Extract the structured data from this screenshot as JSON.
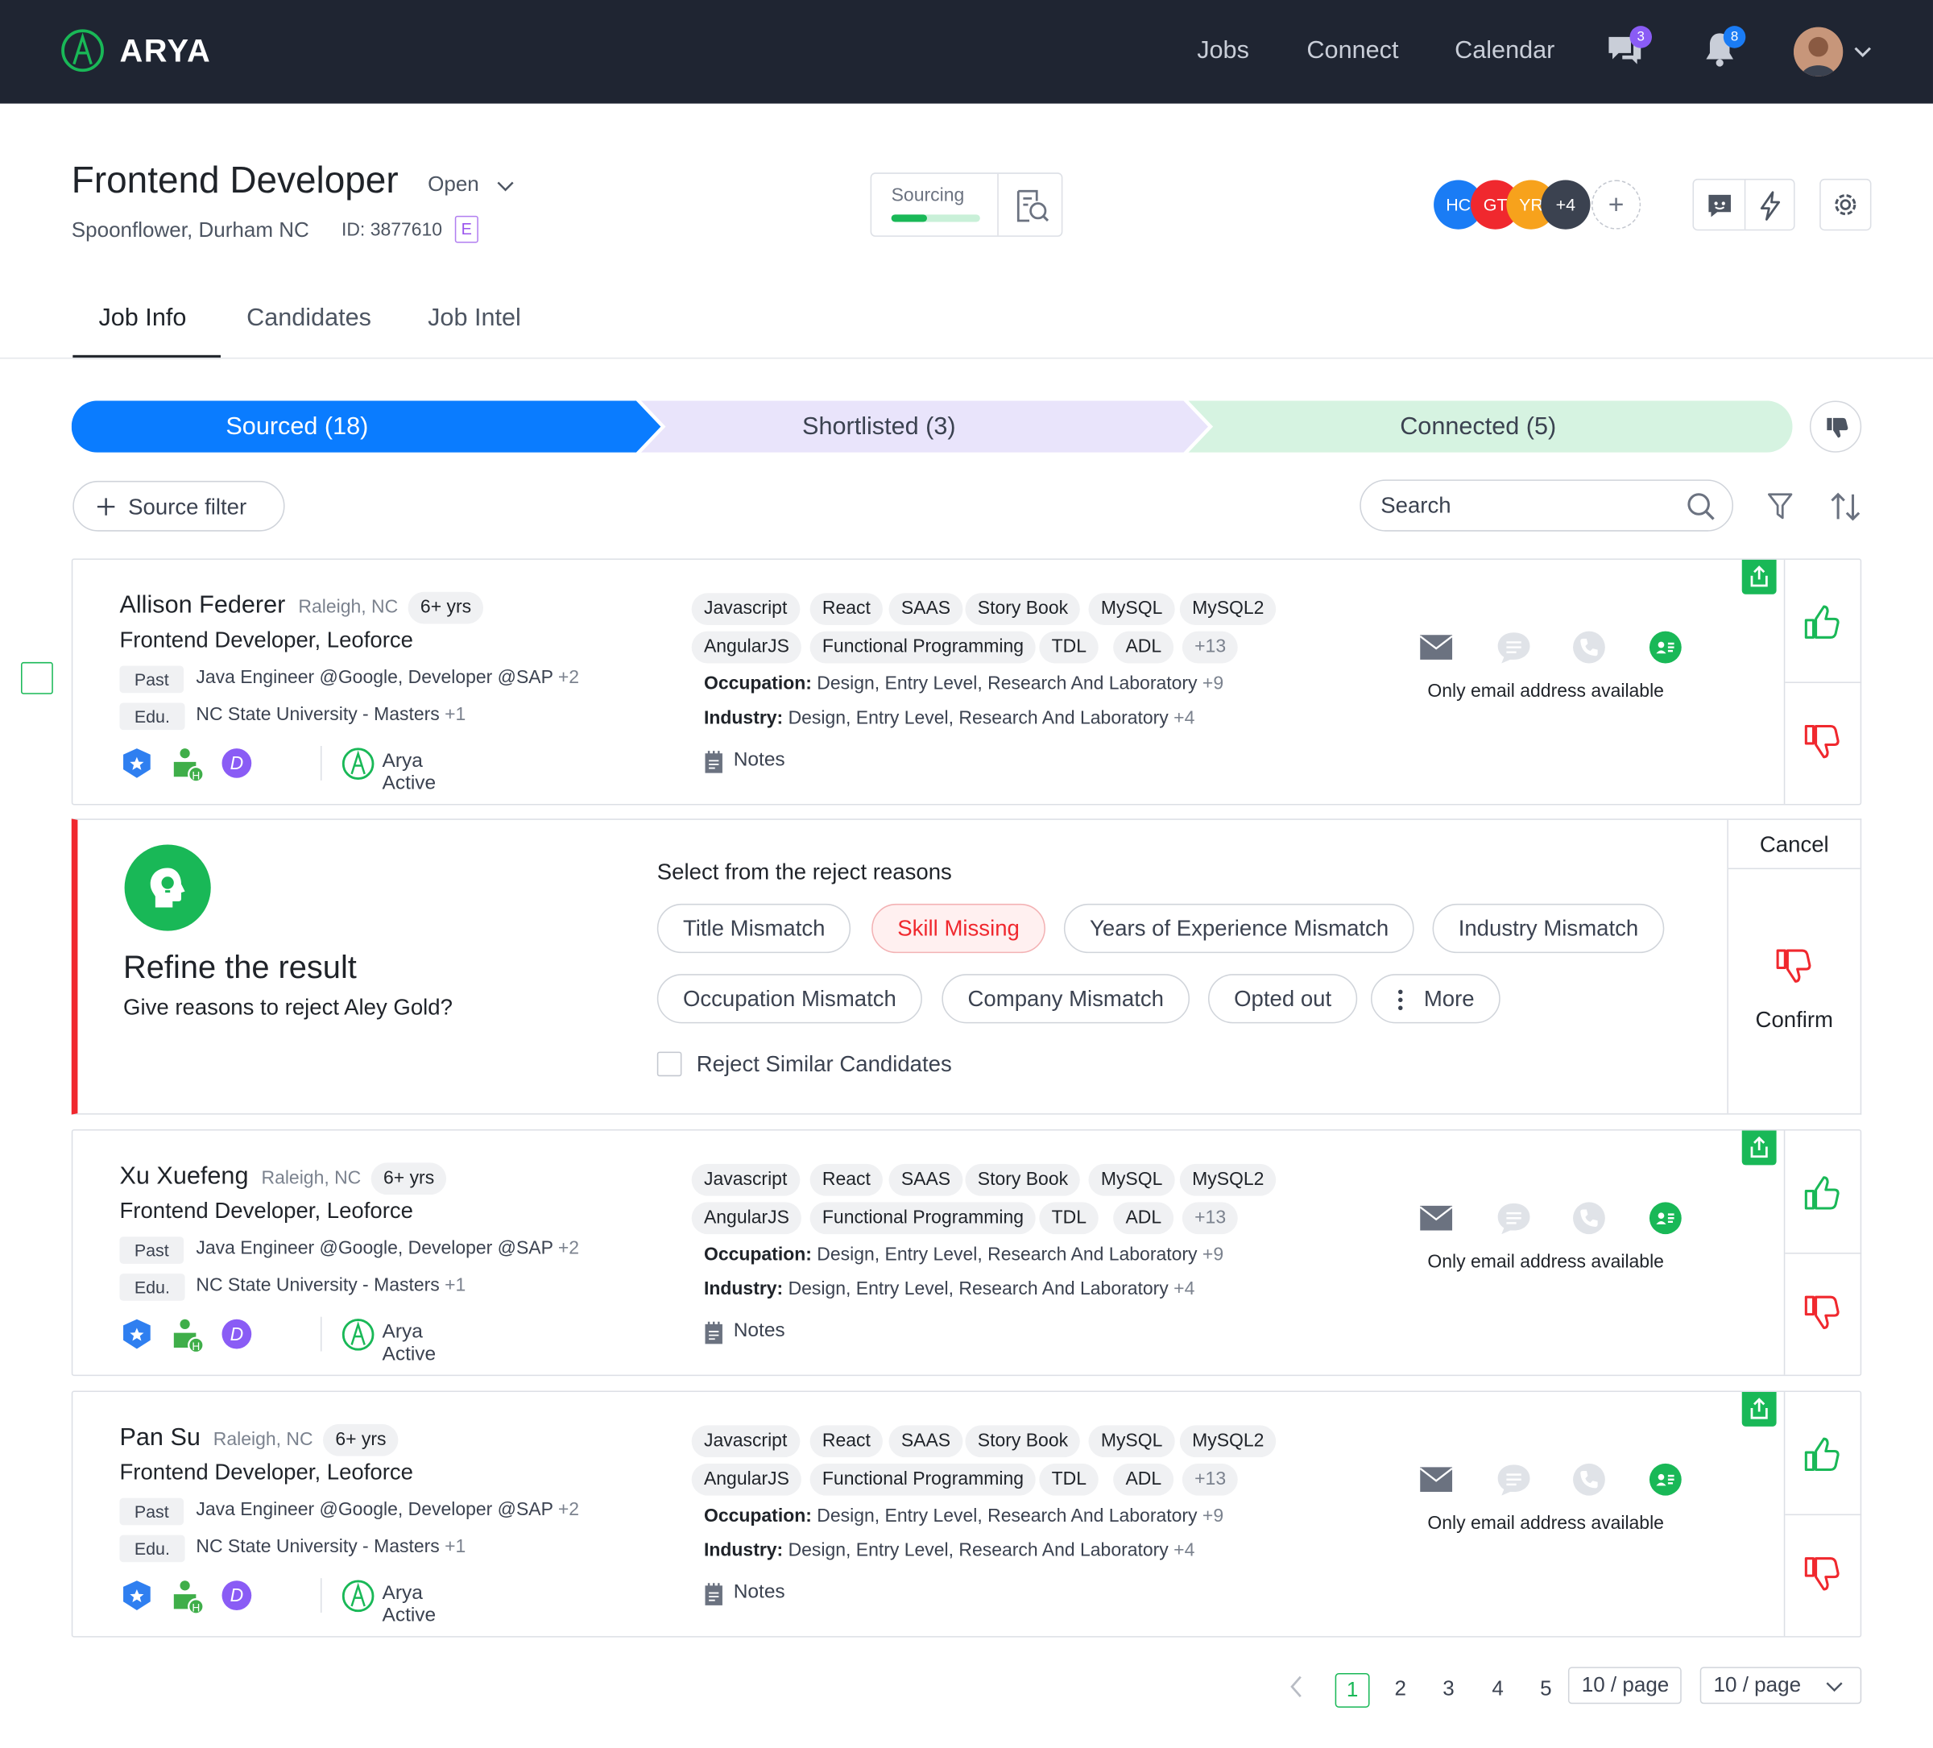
{
  "nav": {
    "brand": "ARYA",
    "links": [
      "Jobs",
      "Connect",
      "Calendar"
    ],
    "chat_badge": "3",
    "notif_badge": "8",
    "colors": {
      "bg": "#1f2532",
      "brand_green": "#19b857"
    }
  },
  "job": {
    "title": "Frontend Developer",
    "status": "Open",
    "location": "Spoonflower, Durham NC",
    "id": "ID: 3877610",
    "tag": "E",
    "sourcing_label": "Sourcing",
    "sourcing_progress": 0.4,
    "team": [
      {
        "initials": "HC",
        "color": "#1a7cf5"
      },
      {
        "initials": "GT",
        "color": "#f0282e"
      },
      {
        "initials": "YR",
        "color": "#f7a21c"
      },
      {
        "initials": "+4",
        "color": "#3b4250"
      }
    ],
    "team_add": "+"
  },
  "tabs": [
    "Job Info",
    "Candidates",
    "Job Intel"
  ],
  "pipeline": {
    "stages": [
      {
        "label": "Sourced (18)",
        "color": "#0a7cff"
      },
      {
        "label": "Shortlisted (3)",
        "color": "#e9e4fb"
      },
      {
        "label": "Connected (5)",
        "color": "#d6f3e1"
      }
    ]
  },
  "filters": {
    "source_filter": "Source filter",
    "search_placeholder": "Search"
  },
  "candidates": [
    {
      "name": "Allison Federer",
      "location": "Raleigh, NC",
      "experience": "6+ yrs",
      "title": "Frontend Developer, Leoforce",
      "past_label": "Past",
      "past": "Java Engineer @Google, Developer @SAP",
      "past_more": "+2",
      "edu_label": "Edu.",
      "edu": "NC State University - Masters",
      "edu_more": "+1",
      "status": "Arya Active",
      "skills_row1": [
        "Javascript",
        "React",
        "SAAS",
        "Story Book",
        "MySQL",
        "MySQL2"
      ],
      "skills_row2": [
        "AngularJS",
        "Functional Programming",
        "TDL",
        "ADL",
        "+13"
      ],
      "occupation_label": "Occupation:",
      "occupation": "Design, Entry Level, Research And Laboratory",
      "occupation_more": "+9",
      "industry_label": "Industry:",
      "industry": "Design, Entry Level, Research And Laboratory",
      "industry_more": "+4",
      "notes": "Notes",
      "contact_note": "Only email address available"
    },
    {
      "name": "Xu Xuefeng",
      "location": "Raleigh, NC",
      "experience": "6+ yrs",
      "title": "Frontend Developer, Leoforce",
      "past_label": "Past",
      "past": "Java Engineer @Google, Developer @SAP",
      "past_more": "+2",
      "edu_label": "Edu.",
      "edu": "NC State University - Masters",
      "edu_more": "+1",
      "status": "Arya Active",
      "skills_row1": [
        "Javascript",
        "React",
        "SAAS",
        "Story Book",
        "MySQL",
        "MySQL2"
      ],
      "skills_row2": [
        "AngularJS",
        "Functional Programming",
        "TDL",
        "ADL",
        "+13"
      ],
      "occupation_label": "Occupation:",
      "occupation": "Design, Entry Level, Research And Laboratory",
      "occupation_more": "+9",
      "industry_label": "Industry:",
      "industry": "Design, Entry Level, Research And Laboratory",
      "industry_more": "+4",
      "notes": "Notes",
      "contact_note": "Only email address available"
    },
    {
      "name": "Pan Su",
      "location": "Raleigh, NC",
      "experience": "6+ yrs",
      "title": "Frontend Developer, Leoforce",
      "past_label": "Past",
      "past": "Java Engineer @Google, Developer @SAP",
      "past_more": "+2",
      "edu_label": "Edu.",
      "edu": "NC State University - Masters",
      "edu_more": "+1",
      "status": "Arya Active",
      "skills_row1": [
        "Javascript",
        "React",
        "SAAS",
        "Story Book",
        "MySQL",
        "MySQL2"
      ],
      "skills_row2": [
        "AngularJS",
        "Functional Programming",
        "TDL",
        "ADL",
        "+13"
      ],
      "occupation_label": "Occupation:",
      "occupation": "Design, Entry Level, Research And Laboratory",
      "occupation_more": "+9",
      "industry_label": "Industry:",
      "industry": "Design, Entry Level, Research And Laboratory",
      "industry_more": "+4",
      "notes": "Notes",
      "contact_note": "Only email address available"
    }
  ],
  "reject": {
    "title": "Refine the result",
    "subtitle": "Give reasons to reject Aley Gold?",
    "prompt": "Select from the reject reasons",
    "reasons": [
      {
        "label": "Title Mismatch",
        "selected": false
      },
      {
        "label": "Skill Missing",
        "selected": true
      },
      {
        "label": "Years of Experience Mismatch",
        "selected": false
      },
      {
        "label": "Industry Mismatch",
        "selected": false
      },
      {
        "label": "Occupation Mismatch",
        "selected": false
      },
      {
        "label": "Company Mismatch",
        "selected": false
      },
      {
        "label": "Opted out",
        "selected": false
      },
      {
        "label": "More",
        "selected": false
      }
    ],
    "similar_label": "Reject Similar Candidates",
    "cancel": "Cancel",
    "confirm": "Confirm"
  },
  "pagination": {
    "pages": [
      "1",
      "2",
      "3",
      "4",
      "5"
    ],
    "current": "1",
    "size_left": "10 / page",
    "size_right": "10 / page"
  }
}
